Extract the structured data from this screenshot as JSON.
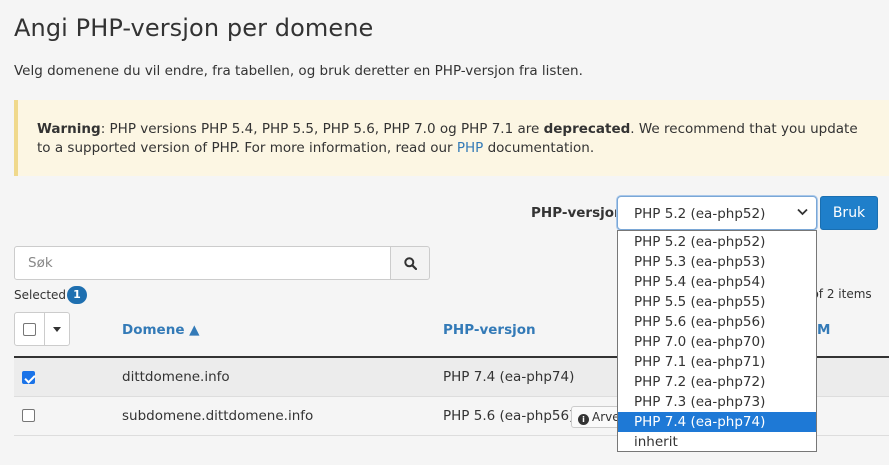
{
  "page": {
    "title": "Angi PHP-versjon per domene",
    "subtitle": "Velg domenene du vil endre, fra tabellen, og bruk deretter en PHP-versjon fra listen."
  },
  "warning": {
    "label": "Warning",
    "text1": ": PHP versions PHP 5.4, PHP 5.5, PHP 5.6, PHP 7.0 og PHP 7.1 are ",
    "emph": "deprecated",
    "text2": ". We recommend that you update to a supported version of PHP. For more information, read our ",
    "link": "PHP",
    "text3": " documentation."
  },
  "php_selector": {
    "label": "PHP-versjon",
    "selected": "PHP 5.2 (ea-php52)",
    "apply_label": "Bruk",
    "options": [
      "PHP 5.2 (ea-php52)",
      "PHP 5.3 (ea-php53)",
      "PHP 5.4 (ea-php54)",
      "PHP 5.5 (ea-php55)",
      "PHP 5.6 (ea-php56)",
      "PHP 7.0 (ea-php70)",
      "PHP 7.1 (ea-php71)",
      "PHP 7.2 (ea-php72)",
      "PHP 7.3 (ea-php73)",
      "PHP 7.4 (ea-php74)",
      "inherit"
    ],
    "highlighted_index": 9
  },
  "search": {
    "placeholder": "Søk"
  },
  "selection": {
    "label": "Selected",
    "count": "1",
    "items_text": "2 of 2 items"
  },
  "table": {
    "col_domain": "Domene ▲",
    "col_php": "PHP-versjon",
    "col_extra": "M",
    "rows": [
      {
        "domain": "dittdomene.info",
        "php": "PHP 7.4 (ea-php74)",
        "checked": true
      },
      {
        "domain": "subdomene.dittdomene.info",
        "php": "PHP 5.6 (ea-php56)",
        "checked": false,
        "inherit_label": "Arve"
      }
    ]
  },
  "colors": {
    "link": "#337ab7",
    "primary_button": "#1f7fca",
    "warning_bg": "#fcf6e3",
    "dropdown_highlight": "#1e79d6"
  }
}
